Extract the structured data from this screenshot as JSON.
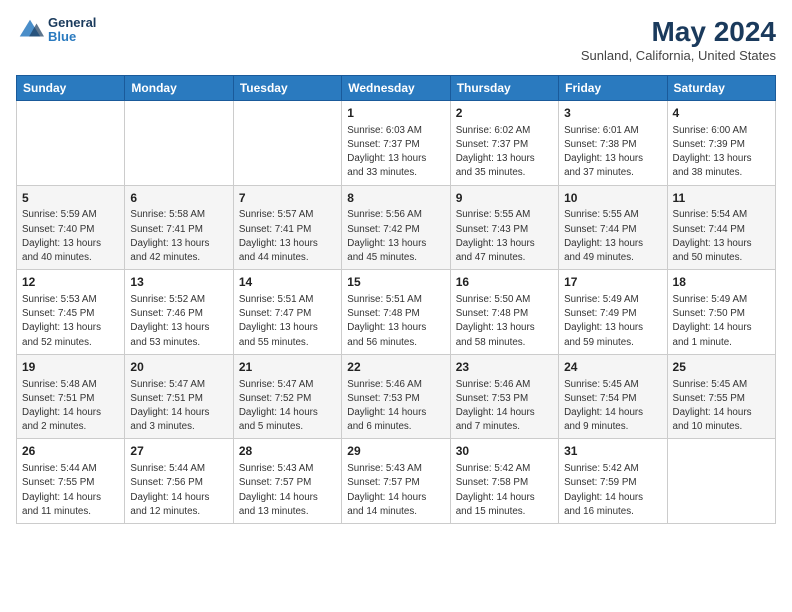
{
  "logo": {
    "line1": "General",
    "line2": "Blue"
  },
  "title": "May 2024",
  "subtitle": "Sunland, California, United States",
  "headers": [
    "Sunday",
    "Monday",
    "Tuesday",
    "Wednesday",
    "Thursday",
    "Friday",
    "Saturday"
  ],
  "weeks": [
    [
      {
        "day": "",
        "content": ""
      },
      {
        "day": "",
        "content": ""
      },
      {
        "day": "",
        "content": ""
      },
      {
        "day": "1",
        "content": "Sunrise: 6:03 AM\nSunset: 7:37 PM\nDaylight: 13 hours and 33 minutes."
      },
      {
        "day": "2",
        "content": "Sunrise: 6:02 AM\nSunset: 7:37 PM\nDaylight: 13 hours and 35 minutes."
      },
      {
        "day": "3",
        "content": "Sunrise: 6:01 AM\nSunset: 7:38 PM\nDaylight: 13 hours and 37 minutes."
      },
      {
        "day": "4",
        "content": "Sunrise: 6:00 AM\nSunset: 7:39 PM\nDaylight: 13 hours and 38 minutes."
      }
    ],
    [
      {
        "day": "5",
        "content": "Sunrise: 5:59 AM\nSunset: 7:40 PM\nDaylight: 13 hours and 40 minutes."
      },
      {
        "day": "6",
        "content": "Sunrise: 5:58 AM\nSunset: 7:41 PM\nDaylight: 13 hours and 42 minutes."
      },
      {
        "day": "7",
        "content": "Sunrise: 5:57 AM\nSunset: 7:41 PM\nDaylight: 13 hours and 44 minutes."
      },
      {
        "day": "8",
        "content": "Sunrise: 5:56 AM\nSunset: 7:42 PM\nDaylight: 13 hours and 45 minutes."
      },
      {
        "day": "9",
        "content": "Sunrise: 5:55 AM\nSunset: 7:43 PM\nDaylight: 13 hours and 47 minutes."
      },
      {
        "day": "10",
        "content": "Sunrise: 5:55 AM\nSunset: 7:44 PM\nDaylight: 13 hours and 49 minutes."
      },
      {
        "day": "11",
        "content": "Sunrise: 5:54 AM\nSunset: 7:44 PM\nDaylight: 13 hours and 50 minutes."
      }
    ],
    [
      {
        "day": "12",
        "content": "Sunrise: 5:53 AM\nSunset: 7:45 PM\nDaylight: 13 hours and 52 minutes."
      },
      {
        "day": "13",
        "content": "Sunrise: 5:52 AM\nSunset: 7:46 PM\nDaylight: 13 hours and 53 minutes."
      },
      {
        "day": "14",
        "content": "Sunrise: 5:51 AM\nSunset: 7:47 PM\nDaylight: 13 hours and 55 minutes."
      },
      {
        "day": "15",
        "content": "Sunrise: 5:51 AM\nSunset: 7:48 PM\nDaylight: 13 hours and 56 minutes."
      },
      {
        "day": "16",
        "content": "Sunrise: 5:50 AM\nSunset: 7:48 PM\nDaylight: 13 hours and 58 minutes."
      },
      {
        "day": "17",
        "content": "Sunrise: 5:49 AM\nSunset: 7:49 PM\nDaylight: 13 hours and 59 minutes."
      },
      {
        "day": "18",
        "content": "Sunrise: 5:49 AM\nSunset: 7:50 PM\nDaylight: 14 hours and 1 minute."
      }
    ],
    [
      {
        "day": "19",
        "content": "Sunrise: 5:48 AM\nSunset: 7:51 PM\nDaylight: 14 hours and 2 minutes."
      },
      {
        "day": "20",
        "content": "Sunrise: 5:47 AM\nSunset: 7:51 PM\nDaylight: 14 hours and 3 minutes."
      },
      {
        "day": "21",
        "content": "Sunrise: 5:47 AM\nSunset: 7:52 PM\nDaylight: 14 hours and 5 minutes."
      },
      {
        "day": "22",
        "content": "Sunrise: 5:46 AM\nSunset: 7:53 PM\nDaylight: 14 hours and 6 minutes."
      },
      {
        "day": "23",
        "content": "Sunrise: 5:46 AM\nSunset: 7:53 PM\nDaylight: 14 hours and 7 minutes."
      },
      {
        "day": "24",
        "content": "Sunrise: 5:45 AM\nSunset: 7:54 PM\nDaylight: 14 hours and 9 minutes."
      },
      {
        "day": "25",
        "content": "Sunrise: 5:45 AM\nSunset: 7:55 PM\nDaylight: 14 hours and 10 minutes."
      }
    ],
    [
      {
        "day": "26",
        "content": "Sunrise: 5:44 AM\nSunset: 7:55 PM\nDaylight: 14 hours and 11 minutes."
      },
      {
        "day": "27",
        "content": "Sunrise: 5:44 AM\nSunset: 7:56 PM\nDaylight: 14 hours and 12 minutes."
      },
      {
        "day": "28",
        "content": "Sunrise: 5:43 AM\nSunset: 7:57 PM\nDaylight: 14 hours and 13 minutes."
      },
      {
        "day": "29",
        "content": "Sunrise: 5:43 AM\nSunset: 7:57 PM\nDaylight: 14 hours and 14 minutes."
      },
      {
        "day": "30",
        "content": "Sunrise: 5:42 AM\nSunset: 7:58 PM\nDaylight: 14 hours and 15 minutes."
      },
      {
        "day": "31",
        "content": "Sunrise: 5:42 AM\nSunset: 7:59 PM\nDaylight: 14 hours and 16 minutes."
      },
      {
        "day": "",
        "content": ""
      }
    ]
  ]
}
